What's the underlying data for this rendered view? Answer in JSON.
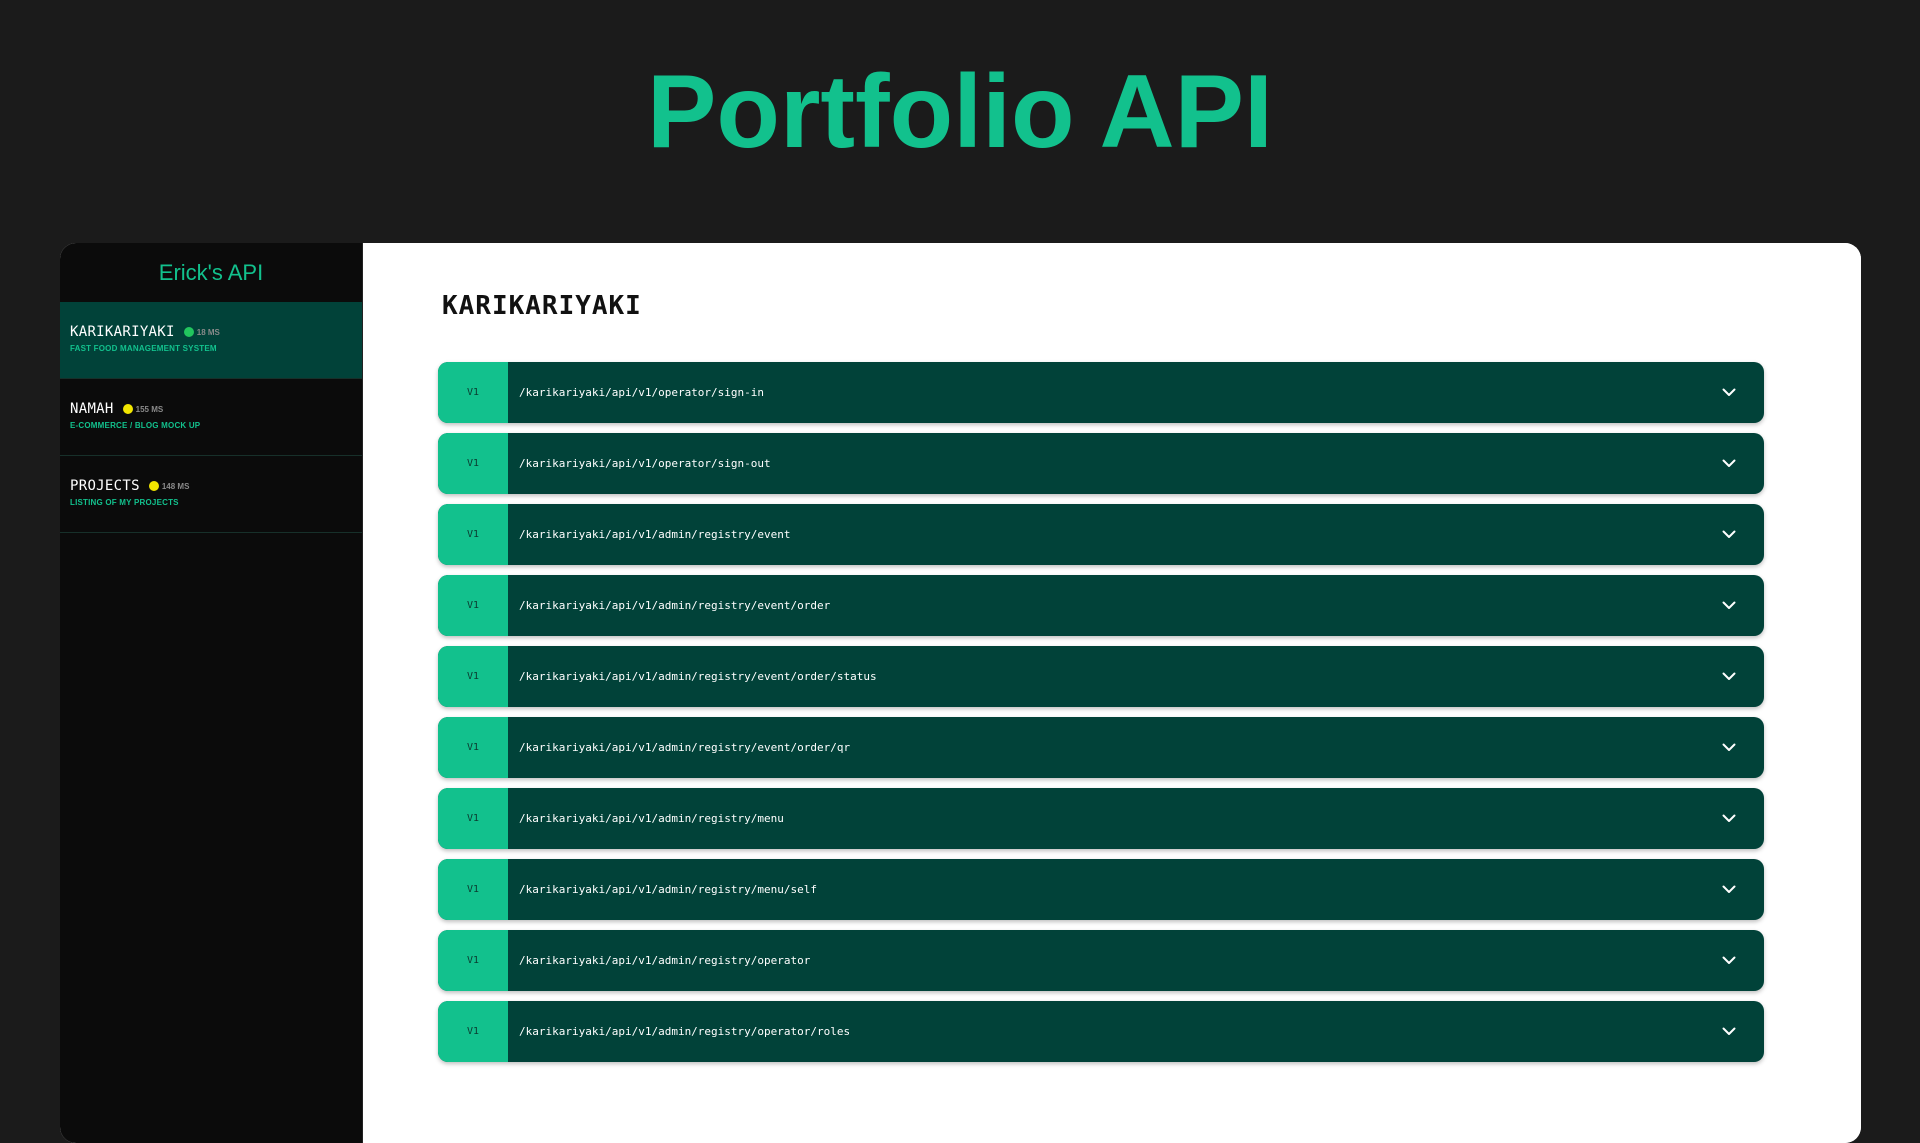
{
  "hero": {
    "title": "Portfolio API"
  },
  "colors": {
    "accent": "#12c18d",
    "row_background": "#014239",
    "page_background": "#1b1b1b",
    "sidebar_background": "#0b0b0b"
  },
  "sidebar": {
    "title": "Erick's API",
    "items": [
      {
        "name": "KARIKARIYAKI",
        "latency": "18 MS",
        "status_color": "#22c55e",
        "subtitle": "FAST FOOD MANAGEMENT SYSTEM",
        "active": true
      },
      {
        "name": "NAMAH",
        "latency": "155 MS",
        "status_color": "#f2e600",
        "subtitle": "E-COMMERCE / BLOG MOCK UP",
        "active": false
      },
      {
        "name": "PROJECTS",
        "latency": "148 MS",
        "status_color": "#f2e600",
        "subtitle": "LISTING OF MY PROJECTS",
        "active": false
      }
    ]
  },
  "main": {
    "title": "KARIKARIYAKI",
    "endpoints": [
      {
        "version": "V1",
        "path": "/karikariyaki/api/v1/operator/sign-in"
      },
      {
        "version": "V1",
        "path": "/karikariyaki/api/v1/operator/sign-out"
      },
      {
        "version": "V1",
        "path": "/karikariyaki/api/v1/admin/registry/event"
      },
      {
        "version": "V1",
        "path": "/karikariyaki/api/v1/admin/registry/event/order"
      },
      {
        "version": "V1",
        "path": "/karikariyaki/api/v1/admin/registry/event/order/status"
      },
      {
        "version": "V1",
        "path": "/karikariyaki/api/v1/admin/registry/event/order/qr"
      },
      {
        "version": "V1",
        "path": "/karikariyaki/api/v1/admin/registry/menu"
      },
      {
        "version": "V1",
        "path": "/karikariyaki/api/v1/admin/registry/menu/self"
      },
      {
        "version": "V1",
        "path": "/karikariyaki/api/v1/admin/registry/operator"
      },
      {
        "version": "V1",
        "path": "/karikariyaki/api/v1/admin/registry/operator/roles"
      }
    ],
    "expand_icon": "chevron-down-icon"
  }
}
